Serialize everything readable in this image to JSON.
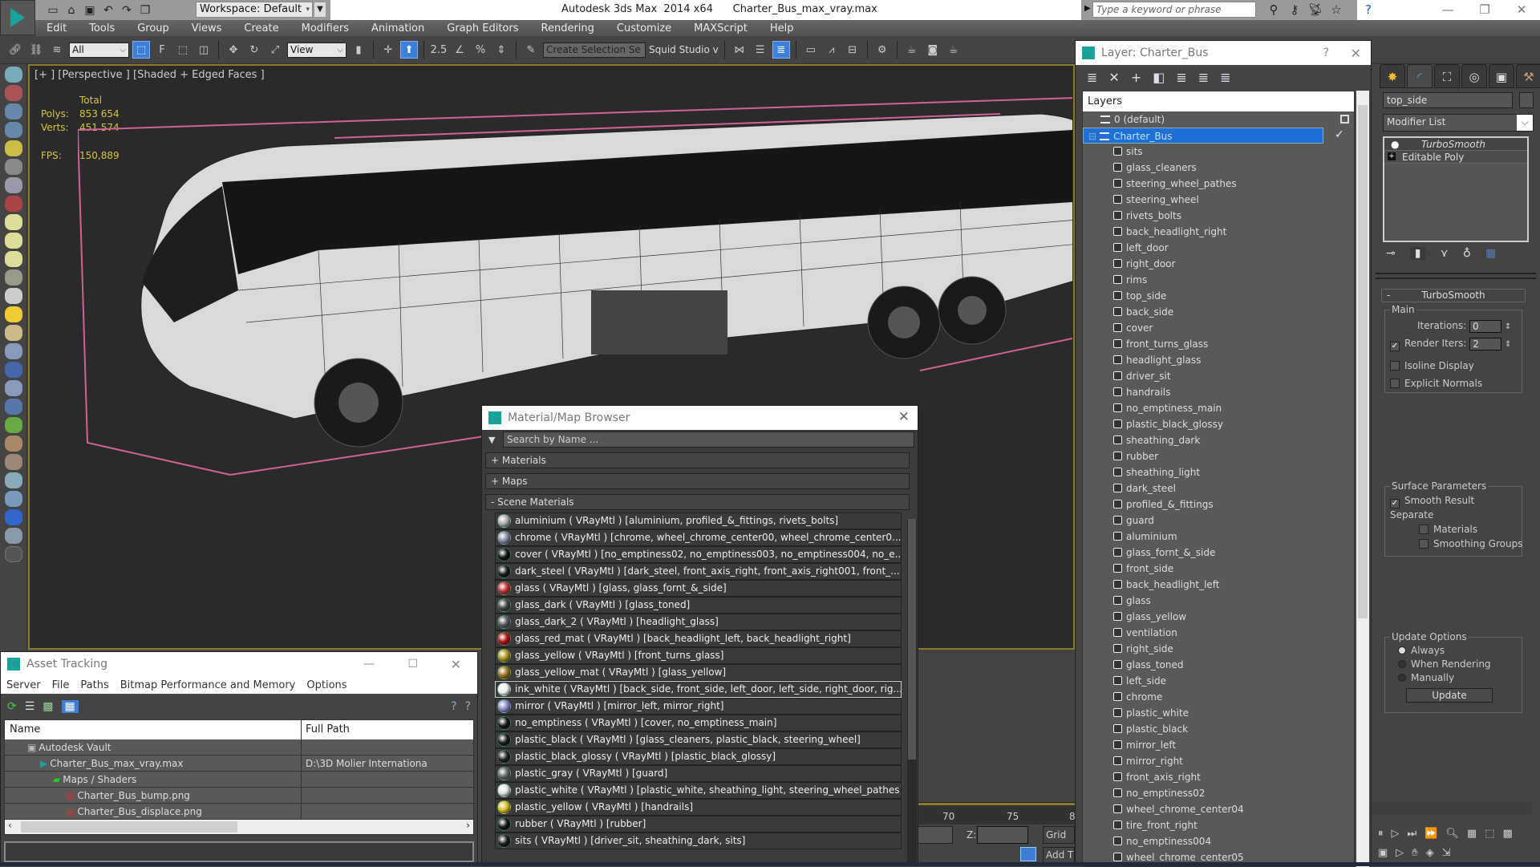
{
  "app": {
    "title": "Autodesk 3ds Max  2014 x64      Charter_Bus_max_vray.max",
    "workspace": "Workspace: Default",
    "search_placeholder": "Type a keyword or phrase",
    "window_controls": {
      "minimize": "—",
      "restore": "❐",
      "close": "✕"
    }
  },
  "menu": [
    "Edit",
    "Tools",
    "Group",
    "Views",
    "Create",
    "Modifiers",
    "Animation",
    "Graph Editors",
    "Rendering",
    "Customize",
    "MAXScript",
    "Help"
  ],
  "toolbar": {
    "selection_filter": "All",
    "ref_coord": "View",
    "named_selection": "Create Selection Se",
    "squid_label": "Squid Studio v"
  },
  "viewport": {
    "label": "[+ ] [Perspective ] [Shaded + Edged Faces ]",
    "stats": {
      "header": "Total",
      "polys_label": "Polys:",
      "polys": "853 654",
      "verts_label": "Verts:",
      "verts": "451 574",
      "fps_label": "FPS:",
      "fps": "150,889"
    },
    "stat_color": "#d9c43a",
    "bbox_color": "#d0609a"
  },
  "layer_dialog": {
    "title": "Layer: Charter_Bus",
    "help": "?",
    "close": "✕",
    "header": "Layers",
    "layers": [
      {
        "name": "0 (default)",
        "type": "layer"
      },
      {
        "name": "Charter_Bus",
        "type": "layer",
        "selected": true,
        "current": true
      }
    ],
    "objects": [
      "sits",
      "glass_cleaners",
      "steering_wheel_pathes",
      "steering_wheel",
      "rivets_bolts",
      "back_headlight_right",
      "left_door",
      "right_door",
      "rims",
      "top_side",
      "back_side",
      "cover",
      "front_turns_glass",
      "headlight_glass",
      "driver_sit",
      "handrails",
      "no_emptiness_main",
      "plastic_black_glossy",
      "sheathing_dark",
      "rubber",
      "sheathing_light",
      "dark_steel",
      "profiled_&_fittings",
      "guard",
      "aluminium",
      "glass_fornt_&_side",
      "front_side",
      "back_headlight_left",
      "glass",
      "glass_yellow",
      "ventilation",
      "right_side",
      "glass_toned",
      "left_side",
      "chrome",
      "plastic_white",
      "plastic_black",
      "mirror_left",
      "mirror_right",
      "front_axis_right",
      "no_emptiness02",
      "wheel_chrome_center04",
      "tire_front_right",
      "no_emptiness004",
      "wheel_chrome_center05"
    ],
    "selection_color": "#1e6fd6"
  },
  "command_panel": {
    "object_name": "top_side",
    "modifier_list": "Modifier List",
    "stack": [
      "TurboSmooth",
      "Editable Poly"
    ],
    "rollout_title": "TurboSmooth",
    "main": {
      "title": "Main",
      "iterations_label": "Iterations:",
      "iterations": "0",
      "render_iters_label": "Render Iters:",
      "render_iters": "2",
      "render_iters_checked": true,
      "isoline_label": "Isoline Display",
      "isoline_checked": false,
      "explicit_label": "Explicit Normals",
      "explicit_checked": false
    },
    "surface": {
      "title": "Surface Parameters",
      "smooth_label": "Smooth Result",
      "smooth_checked": true,
      "separate_label": "Separate",
      "materials_label": "Materials",
      "smoothing_groups_label": "Smoothing Groups"
    },
    "update": {
      "title": "Update Options",
      "options": [
        "Always",
        "When Rendering",
        "Manually"
      ],
      "selected": "Always",
      "button": "Update"
    }
  },
  "material_browser": {
    "title": "Material/Map Browser",
    "search_placeholder": "Search by Name ...",
    "sections": [
      "+ Materials",
      "+ Maps",
      "- Scene Materials"
    ],
    "materials": [
      {
        "text": "aluminium  ( VRayMtl )  [aluminium, profiled_&_fittings, rivets_bolts]",
        "color": "#aaaaaa"
      },
      {
        "text": "chrome   ( VRayMtl )  [chrome, wheel_chrome_center00, wheel_chrome_center0...",
        "color": "#8888aa"
      },
      {
        "text": "cover  ( VRayMtl ) [no_emptiness02, no_emptiness003, no_emptiness004, no_e...",
        "color": "#111111"
      },
      {
        "text": "dark_steel  ( VRayMtl ) [dark_steel, front_axis_right, front_axis_right001, front_...",
        "color": "#1a1a1a"
      },
      {
        "text": "glass  ( VRayMtl ) [glass, glass_fornt_&_side]",
        "color": "#c03030"
      },
      {
        "text": "glass_dark  ( VRayMtl ) [glass_toned]",
        "color": "#444444"
      },
      {
        "text": "glass_dark_2  ( VRayMtl ) [headlight_glass]",
        "color": "#555566"
      },
      {
        "text": "glass_red_mat  ( VRayMtl ) [back_headlight_left, back_headlight_right]",
        "color": "#b01010"
      },
      {
        "text": "glass_yellow  ( VRayMtl ) [front_turns_glass]",
        "color": "#b09020"
      },
      {
        "text": "glass_yellow_mat  ( VRayMtl ) [glass_yellow]",
        "color": "#a07020"
      },
      {
        "text": "ink_white  ( VRayMtl ) [back_side, front_side, left_door, left_side, right_door, rig...",
        "color": "#eeeeee",
        "selected": true
      },
      {
        "text": "mirror  ( VRayMtl )  [mirror_left, mirror_right]",
        "color": "#8888cc"
      },
      {
        "text": "no_emptiness  ( VRayMtl )  [cover, no_emptiness_main]",
        "color": "#151515"
      },
      {
        "text": "plastic_black  ( VRayMtl ) [glass_cleaners, plastic_black, steering_wheel]",
        "color": "#1a1a1a"
      },
      {
        "text": "plastic_black_glossy  ( VRayMtl ) [plastic_black_glossy]",
        "color": "#222222"
      },
      {
        "text": "plastic_gray  ( VRayMtl )  [guard]",
        "color": "#666666"
      },
      {
        "text": "plastic_white  ( VRayMtl )  [plastic_white, sheathing_light, steering_wheel_pathes]",
        "color": "#e0e0e0"
      },
      {
        "text": "plastic_yellow  ( VRayMtl )  [handrails]",
        "color": "#d8b820"
      },
      {
        "text": "rubber  ( VRayMtl )  [rubber]",
        "color": "#151515"
      },
      {
        "text": "sits  ( VRayMtl )  [driver_sit, sheathing_dark, sits]",
        "color": "#1c1c1c"
      }
    ]
  },
  "asset_tracking": {
    "title": "Asset Tracking",
    "menu": [
      "Server",
      "File",
      "Paths",
      "Bitmap Performance and Memory",
      "Options"
    ],
    "columns": [
      "Name",
      "Full Path"
    ],
    "rows": [
      {
        "name": "Autodesk Vault",
        "path": "",
        "indent": 1,
        "icon": "vault-icon"
      },
      {
        "name": "Charter_Bus_max_vray.max",
        "path": "D:\\3D Molier Internationa",
        "indent": 2,
        "icon": "max-file-icon"
      },
      {
        "name": "Maps / Shaders",
        "path": "",
        "indent": 3,
        "icon": "maps-icon"
      },
      {
        "name": "Charter_Bus_bump.png",
        "path": "",
        "indent": 4,
        "icon": "png-icon"
      },
      {
        "name": "Charter_Bus_displace.png",
        "path": "",
        "indent": 4,
        "icon": "png-icon"
      }
    ]
  },
  "timeline": {
    "ticks": [
      "70",
      "75",
      "8"
    ],
    "z_label": "Z:",
    "grid_label": "Grid =",
    "add_time_tag": "Add T"
  }
}
